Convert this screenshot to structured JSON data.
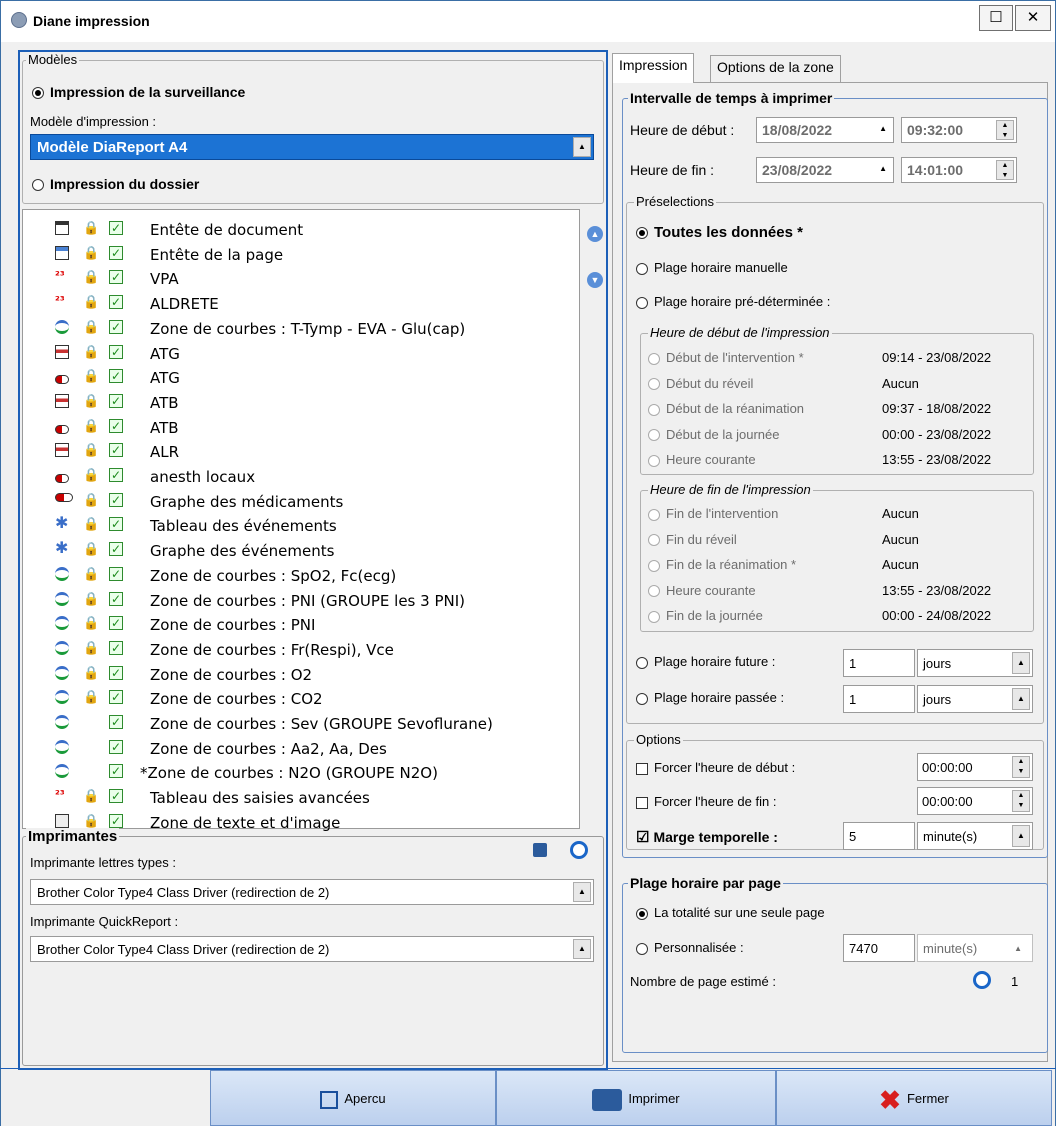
{
  "window": {
    "title": "Diane impression",
    "maximize_label": "☐",
    "close_label": "✕"
  },
  "models": {
    "legend": "Modèles",
    "surv_label": "Impression de la surveillance",
    "model_label": "Modèle d'impression :",
    "model_value": "Modèle DiaReport A4",
    "dossier_label": "Impression du dossier"
  },
  "tree": [
    {
      "icon": "header-icon",
      "lock": true,
      "text": "Entête de document"
    },
    {
      "icon": "page-header-icon",
      "lock": true,
      "text": "Entête de la page"
    },
    {
      "icon": "table-123-icon",
      "lock": true,
      "text": "VPA"
    },
    {
      "icon": "table-123-icon",
      "lock": true,
      "text": "ALDRETE"
    },
    {
      "icon": "curve-icon",
      "lock": true,
      "text": "Zone de courbes : T-Tymp - EVA - Glu(cap)"
    },
    {
      "icon": "drug-table-icon",
      "lock": true,
      "text": "ATG"
    },
    {
      "icon": "pill-text-icon",
      "lock": true,
      "text": "ATG"
    },
    {
      "icon": "drug-table-icon",
      "lock": true,
      "text": "ATB"
    },
    {
      "icon": "pill-text-icon",
      "lock": true,
      "text": "ATB"
    },
    {
      "icon": "drug-table-icon",
      "lock": true,
      "text": "ALR"
    },
    {
      "icon": "pill-text-icon",
      "lock": true,
      "text": "anesth locaux"
    },
    {
      "icon": "pill-icon",
      "lock": true,
      "text": "Graphe des médicaments"
    },
    {
      "icon": "event-table-icon",
      "lock": true,
      "text": "Tableau des événements"
    },
    {
      "icon": "event-icon",
      "lock": true,
      "text": "Graphe des événements"
    },
    {
      "icon": "curve-icon",
      "lock": true,
      "text": "Zone de courbes : SpO2, Fc(ecg)"
    },
    {
      "icon": "curve-icon",
      "lock": true,
      "text": "Zone de courbes : PNI (GROUPE les 3 PNI)"
    },
    {
      "icon": "curve-icon",
      "lock": true,
      "text": "Zone de courbes : PNI"
    },
    {
      "icon": "curve-icon",
      "lock": true,
      "text": "Zone de courbes : Fr(Respi), Vce"
    },
    {
      "icon": "curve-icon",
      "lock": true,
      "text": "Zone de courbes : O2"
    },
    {
      "icon": "curve-icon",
      "lock": true,
      "text": "Zone de courbes : CO2"
    },
    {
      "icon": "curve-icon",
      "lock": false,
      "text": "Zone de courbes : Sev (GROUPE Sevoflurane)"
    },
    {
      "icon": "curve-icon",
      "lock": false,
      "text": "Zone de courbes : Aa2, Aa, Des"
    },
    {
      "icon": "curve-icon",
      "lock": false,
      "text": "*Zone de courbes : N2O (GROUPE N2O)"
    },
    {
      "icon": "table-123-icon",
      "lock": true,
      "text": "Tableau des saisies avancées"
    },
    {
      "icon": "text-image-icon",
      "lock": true,
      "text": "Zone de texte et d'image"
    }
  ],
  "printers": {
    "legend": "Imprimantes",
    "letters_label": "Imprimante lettres types :",
    "letters_value": "Brother Color Type4 Class Driver (redirection de 2)",
    "qr_label": "Imprimante QuickReport :",
    "qr_value": "Brother Color Type4 Class Driver (redirection de 2)"
  },
  "tabs": {
    "impression": "Impression",
    "options_zone": "Options de la zone"
  },
  "interval": {
    "legend": "Intervalle de temps à imprimer",
    "start_label": "Heure de début :",
    "start_date": "18/08/2022",
    "start_time": "09:32:00",
    "end_label": "Heure de fin :",
    "end_date": "23/08/2022",
    "end_time": "14:01:00"
  },
  "presel": {
    "legend": "Préselections",
    "all": "Toutes les données *",
    "manual": "Plage horaire manuelle",
    "predef": "Plage horaire pré-déterminée :",
    "start_legend": "Heure de début de l'impression",
    "start_items": [
      {
        "label": "Début de l'intervention *",
        "value": "09:14 - 23/08/2022"
      },
      {
        "label": "Début du réveil",
        "value": "Aucun"
      },
      {
        "label": "Début de la réanimation",
        "value": "09:37 - 18/08/2022"
      },
      {
        "label": "Début de la journée",
        "value": "00:00 - 23/08/2022"
      },
      {
        "label": "Heure courante",
        "value": "13:55 - 23/08/2022"
      }
    ],
    "end_legend": "Heure de fin de l'impression",
    "end_items": [
      {
        "label": "Fin de l'intervention",
        "value": "Aucun"
      },
      {
        "label": "Fin du réveil",
        "value": "Aucun"
      },
      {
        "label": "Fin de la réanimation *",
        "value": "Aucun"
      },
      {
        "label": "Heure courante",
        "value": "13:55 - 23/08/2022"
      },
      {
        "label": "Fin de la journée",
        "value": "00:00 - 24/08/2022"
      }
    ],
    "future_label": "Plage horaire future :",
    "future_value": "1",
    "future_unit": "jours",
    "past_label": "Plage horaire passée :",
    "past_value": "1",
    "past_unit": "jours"
  },
  "options": {
    "legend": "Options",
    "force_start": "Forcer l'heure de début :",
    "force_start_value": "00:00:00",
    "force_end": "Forcer l'heure de fin :",
    "force_end_value": "00:00:00",
    "margin_label": "Marge temporelle :",
    "margin_check": "☑",
    "margin_value": "5",
    "margin_unit": "minute(s)"
  },
  "perpage": {
    "legend": "Plage horaire par page",
    "single": "La totalité sur une seule page",
    "custom": "Personnalisée :",
    "custom_value": "7470",
    "custom_unit": "minute(s)",
    "estimate_label": "Nombre de page estimé :",
    "estimate_value": "1"
  },
  "buttons": {
    "preview": "Apercu",
    "print": "Imprimer",
    "close": "Fermer"
  }
}
